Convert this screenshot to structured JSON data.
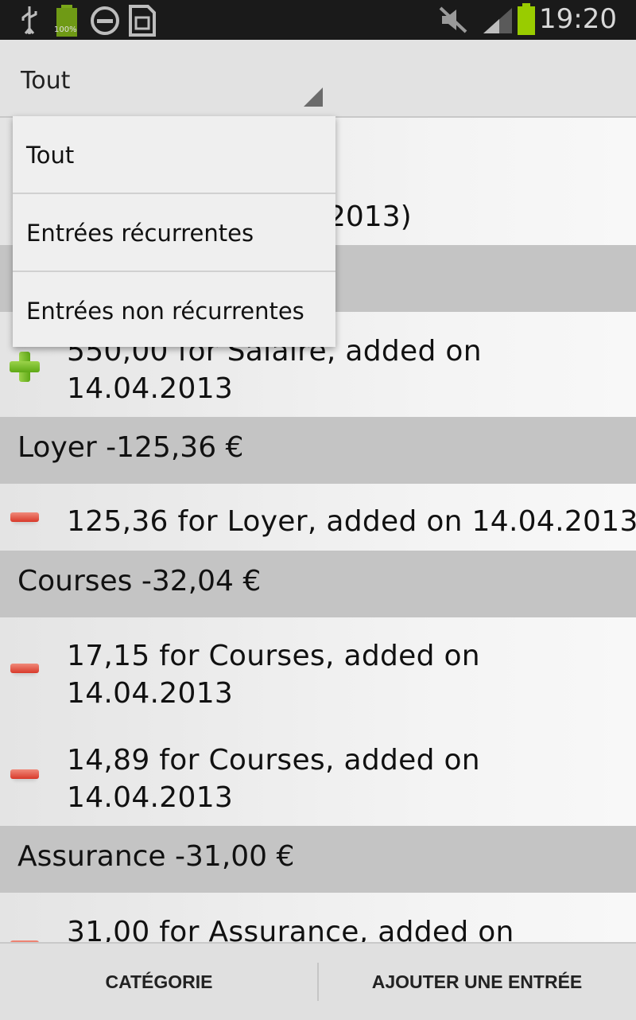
{
  "status_bar": {
    "time": "19:20",
    "battery_label": "100%",
    "icons": [
      "usb-icon",
      "battery-full-icon",
      "do-not-disturb-icon",
      "sim-card-icon",
      "mute-icon",
      "signal-icon",
      "battery-icon"
    ]
  },
  "filter_spinner": {
    "selected": "Tout",
    "options": [
      "Tout",
      "Entrées récurrentes",
      "Entrées non récurrentes"
    ]
  },
  "summary": {
    "partial_text": "2013)"
  },
  "groups": [
    {
      "title": "",
      "entries": [
        {
          "type": "income",
          "text": "550,00 for Salaire, added on 14.04.2013"
        }
      ]
    },
    {
      "title": "Loyer -125,36 €",
      "entries": [
        {
          "type": "expense",
          "text": "125,36 for Loyer, added on 14.04.2013"
        }
      ]
    },
    {
      "title": "Courses -32,04 €",
      "entries": [
        {
          "type": "expense",
          "text": "17,15 for Courses, added on 14.04.2013"
        },
        {
          "type": "expense",
          "text": "14,89 for Courses, added on 14.04.2013"
        }
      ]
    },
    {
      "title": "Assurance -31,00 €",
      "entries": [
        {
          "type": "expense",
          "text": "31,00 for Assurance, added on"
        }
      ]
    }
  ],
  "bottom_bar": {
    "category_label": "CATÉGORIE",
    "add_entry_label": "AJOUTER UNE ENTRÉE"
  },
  "colors": {
    "section_header": "#c4c4c4",
    "income_icon": "#6cb620",
    "expense_icon": "#e04a3a",
    "status_bar": "#1a1a1a"
  }
}
